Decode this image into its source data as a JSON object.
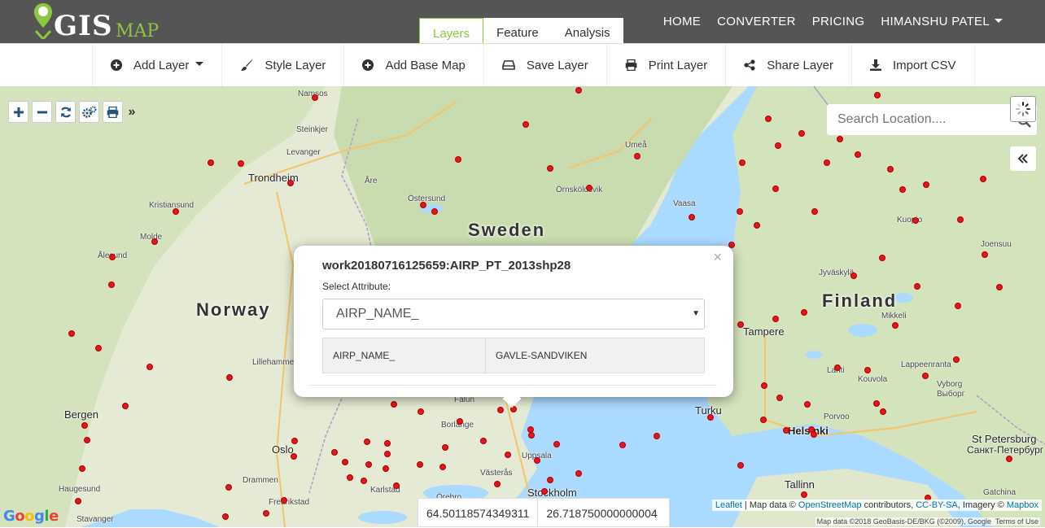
{
  "header": {
    "logo_main": "GIS",
    "logo_sub": "MAP",
    "tabs": [
      {
        "label": "Layers",
        "active": true
      },
      {
        "label": "Feature",
        "active": false
      },
      {
        "label": "Analysis",
        "active": false
      }
    ],
    "nav": [
      "HOME",
      "CONVERTER",
      "PRICING",
      "HIMANSHU PATEL"
    ]
  },
  "toolbar": {
    "add_layer": "Add Layer",
    "style_layer": "Style Layer",
    "add_base_map": "Add Base Map",
    "save_layer": "Save Layer",
    "print_layer": "Print Layer",
    "share_layer": "Share Layer",
    "import_csv": "Import CSV"
  },
  "search": {
    "placeholder": "Search Location...."
  },
  "map": {
    "countries": {
      "sweden": "Sweden",
      "norway": "Norway",
      "finland": "Finland"
    },
    "cities": {
      "trondheim": "Trondheim",
      "bergen": "Bergen",
      "oslo": "Oslo",
      "turku": "Turku",
      "helsinki": "Helsinki",
      "tampere": "Tampere",
      "stockholm": "Stockholm",
      "tallinn": "Tallinn",
      "st_petersburg": "St Petersburg",
      "st_petersburg_ru": "Санкт-Петербург"
    },
    "places": {
      "namsos": "Namsos",
      "steinkjer": "Steinkjer",
      "levanger": "Levanger",
      "kristiansund": "Kristiansund",
      "molde": "Molde",
      "alesund": "Ålesund",
      "are": "Åre",
      "ostersund": "Östersund",
      "umea": "Umeå",
      "ornskoldsvik": "Örnsköldsvik",
      "vaasa": "Vaasa",
      "kuopio": "Kuopio",
      "joensuu": "Joensuu",
      "jyvaskyla": "Jyväskylä",
      "mikkeli": "Mikkeli",
      "lahti": "Lahti",
      "kouvola": "Kouvola",
      "lappeenranta": "Lappeenranta",
      "vyborg": "Vyborg",
      "vyborg_ru": "Выборг",
      "porvoo": "Porvoo",
      "lillehammer": "Lillehammer",
      "falun": "Falun",
      "borlange": "Borlänge",
      "uppsala": "Uppsala",
      "vasteras": "Västerås",
      "karlstad": "Karlstad",
      "drammen": "Drammen",
      "fredrikstad": "Fredrikstad",
      "haugesund": "Haugesund",
      "stavanger": "Stavanger",
      "gatchina": "Gatchina",
      "orebro": "Örebro"
    }
  },
  "popup": {
    "title": "work20180716125659:AIRP_PT_2013shp28",
    "select_label": "Select Attribute:",
    "selected_attribute": "AIRP_NAME_",
    "row": {
      "key": "AIRP_NAME_",
      "value": "GAVLE-SANDVIKEN"
    },
    "close": "×"
  },
  "coordinates": {
    "lat": "64.50118574349311",
    "lng": "26.718750000000004"
  },
  "attribution": {
    "leaflet": "Leaflet",
    "sep1": " | Map data © ",
    "osm": "OpenStreetMap",
    "sep2": " contributors, ",
    "cc": "CC-BY-SA",
    "sep3": ", Imagery © ",
    "mapbox": "Mapbox",
    "line2": "Map data ©2018 GeoBasis-DE/BKG (©2009), Google",
    "terms": "Terms of Use"
  },
  "google_logo": "Google",
  "colors": {
    "brand": "#8dc63f",
    "topbar": "#555555",
    "marker": "#e8141d",
    "water": "#aadaff"
  }
}
